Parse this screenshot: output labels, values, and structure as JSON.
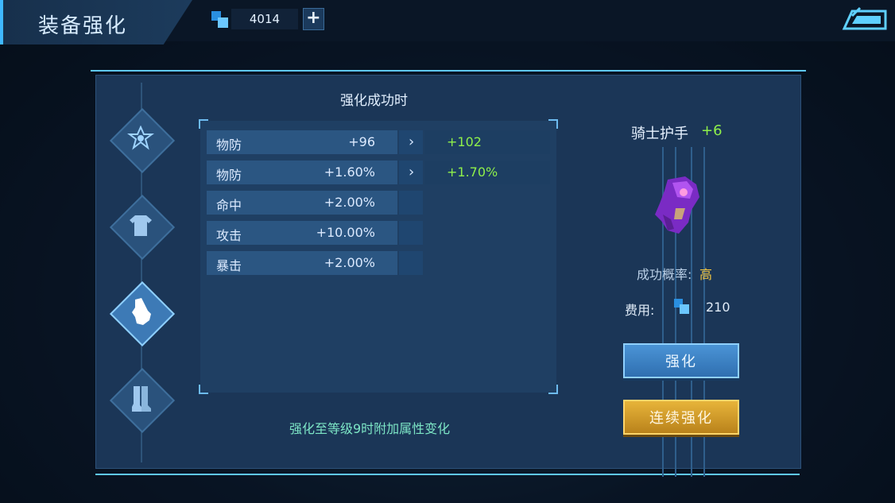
{
  "header": {
    "title": "装备强化",
    "currency_value": "4014",
    "add_label": "+"
  },
  "panel": {
    "title": "强化成功时",
    "stats": [
      {
        "name": "物防",
        "current": "+96",
        "arrow": "›",
        "next": "+102"
      },
      {
        "name": "物防",
        "current": "+1.60%",
        "arrow": "›",
        "next": "+1.70%"
      },
      {
        "name": "命中",
        "current": "+2.00%",
        "arrow": "",
        "next": ""
      },
      {
        "name": "攻击",
        "current": "+10.00%",
        "arrow": "",
        "next": ""
      },
      {
        "name": "暴击",
        "current": "+2.00%",
        "arrow": "",
        "next": ""
      }
    ],
    "footer_note": "强化至等级9时附加属性变化"
  },
  "slots": [
    {
      "icon": "emblem-icon",
      "active": false
    },
    {
      "icon": "armor-icon",
      "active": false
    },
    {
      "icon": "gauntlet-icon",
      "active": true
    },
    {
      "icon": "boots-icon",
      "active": false
    }
  ],
  "item": {
    "name": "骑士护手",
    "level": "+6",
    "icon": "purple-gauntlet-icon",
    "success_rate_label": "成功概率:",
    "success_rate_value": "高",
    "cost_label": "费用:",
    "cost_value": "210"
  },
  "buttons": {
    "enhance": "强化",
    "continuous_enhance": "连续强化"
  },
  "colors": {
    "accent": "#5fc8ff",
    "increase": "#8ff04a",
    "rate_high": "#f3c640",
    "enhance_button": "#3d82c4",
    "continuous_button": "#d39f2c"
  }
}
